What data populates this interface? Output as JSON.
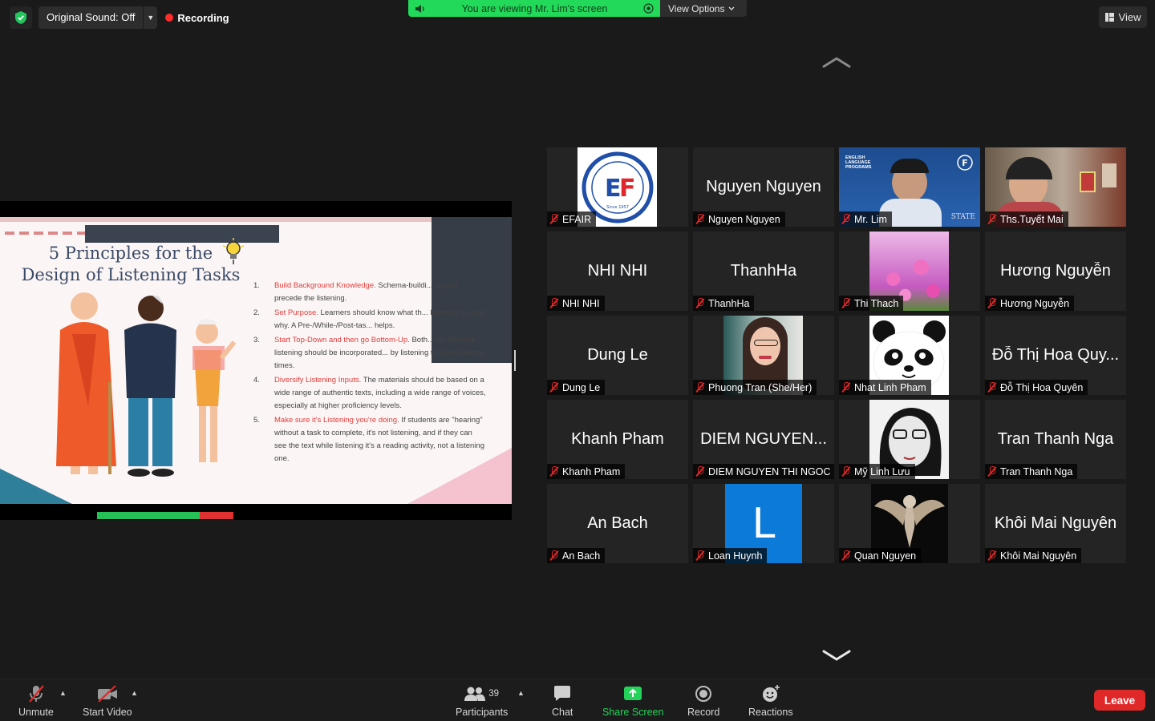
{
  "top": {
    "original_sound_label": "Original Sound: Off",
    "recording_label": "Recording",
    "viewing_banner": "You are viewing Mr. Lim's screen",
    "view_options_label": "View Options",
    "view_label": "View"
  },
  "slide": {
    "title_line1": "5 Principles for the",
    "title_line2": "Design of Listening Tasks",
    "principles": [
      {
        "num": "1.",
        "heading": "Build Background Knowledge.",
        "body": " Schema-buildi... should precede the listening."
      },
      {
        "num": "2.",
        "heading": "Set Purpose.",
        "body": " Learners should know what th... listening for and why. A Pre-/While-/Post-tas... helps."
      },
      {
        "num": "3.",
        "heading": "Start Top-Down and then go Bottom-Up.",
        "body": " Both... for effective listening should be incorporated... by listening to a text several times."
      },
      {
        "num": "4.",
        "heading": "Diversify Listening Inputs.",
        "body": " The materials should be based on a wide range of authentic texts, including a wide range of voices, especially at higher proficiency levels."
      },
      {
        "num": "5.",
        "heading": "Make sure it's Listening you're doing.",
        "body": " If students are \"hearing\" without a task to complete, it's not listening, and if they can see the text while listening it's a reading activity, not a listening one."
      }
    ]
  },
  "gallery": {
    "tiles": [
      {
        "name": "EFAIR",
        "big": "",
        "kind": "logo"
      },
      {
        "name": "Nguyen Nguyen",
        "big": "Nguyen Nguyen",
        "kind": "name"
      },
      {
        "name": "Mr. Lim",
        "big": "",
        "kind": "video"
      },
      {
        "name": "Ths.Tuyết Mai",
        "big": "",
        "kind": "video2"
      },
      {
        "name": "NHI NHI",
        "big": "NHI NHI",
        "kind": "name"
      },
      {
        "name": "ThanhHa",
        "big": "ThanhHa",
        "kind": "name"
      },
      {
        "name": "Thi Thach",
        "big": "",
        "kind": "flowers"
      },
      {
        "name": "Hương Nguyễn",
        "big": "Hương Nguyễn",
        "kind": "name"
      },
      {
        "name": "Dung Le",
        "big": "Dung Le",
        "kind": "name"
      },
      {
        "name": "Phuong Tran  (She/Her)",
        "big": "",
        "kind": "portrait"
      },
      {
        "name": "Nhat Linh Pham",
        "big": "",
        "kind": "panda"
      },
      {
        "name": "Đỗ Thị Hoa Quyên",
        "big": "Đỗ Thị Hoa Quy...",
        "kind": "name"
      },
      {
        "name": "Khanh Pham",
        "big": "Khanh Pham",
        "kind": "name"
      },
      {
        "name": "DIEM NGUYEN THI NGOC",
        "big": "DIEM NGUYEN...",
        "kind": "name"
      },
      {
        "name": "Mỹ Linh Lưu",
        "big": "",
        "kind": "sketch"
      },
      {
        "name": "Tran Thanh Nga",
        "big": "Tran Thanh Nga",
        "kind": "name"
      },
      {
        "name": "An Bach",
        "big": "An Bach",
        "kind": "name"
      },
      {
        "name": "Loan Huynh",
        "big": "",
        "kind": "letter"
      },
      {
        "name": "Quan Nguyen",
        "big": "",
        "kind": "owl"
      },
      {
        "name": "Khôi Mai Nguyên",
        "big": "Khôi Mai Nguyên",
        "kind": "name"
      }
    ],
    "letter_avatar": "L",
    "lim_badge": "F",
    "lim_banner": "ENGLISH LANGUAGE PROGRAMS",
    "lim_state": "STATE",
    "efair_since": "Since 1957"
  },
  "toolbar": {
    "unmute": "Unmute",
    "start_video": "Start Video",
    "participants": "Participants",
    "participants_count": "39",
    "chat": "Chat",
    "share_screen": "Share Screen",
    "record": "Record",
    "reactions": "Reactions",
    "leave": "Leave"
  },
  "colors": {
    "banner_green": "#23d959",
    "leave_red": "#e02828",
    "active_speaker": "#c4e35a",
    "share_green": "#25d35a"
  }
}
